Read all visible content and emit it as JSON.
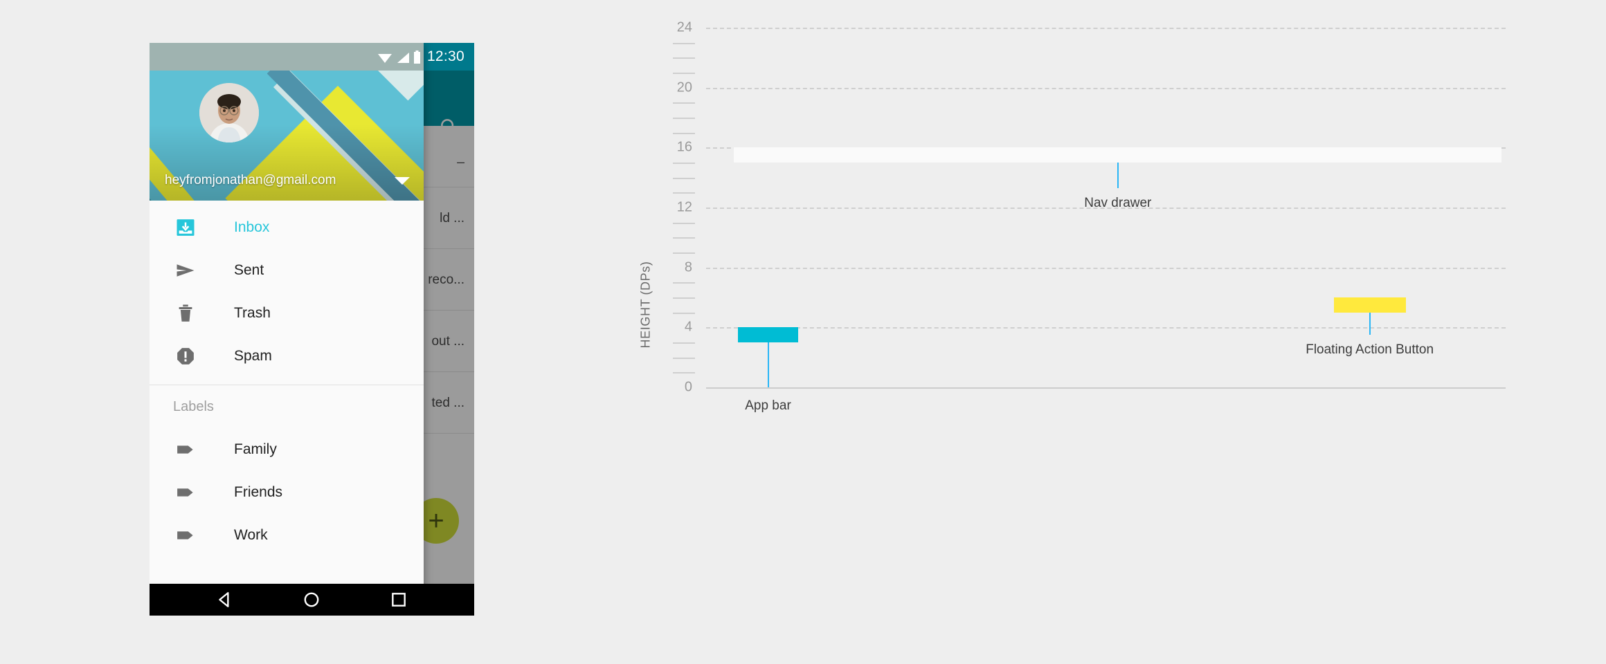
{
  "phone": {
    "status_bar": {
      "time": "12:30",
      "icons": [
        "wifi-icon",
        "signal-icon",
        "battery-icon"
      ]
    },
    "app": {
      "search_icon": "search-icon",
      "mail_snippets": [
        "_",
        "ld ...",
        "reco...",
        "out ...",
        "ted ..."
      ],
      "fab_label": "+",
      "fab_icon": "plus-icon",
      "fab_color": "#cddc39",
      "app_bar_color": "#0097a7"
    },
    "drawer": {
      "account_email": "heyfromjonathan@gmail.com",
      "account_caret_icon": "chevron-down-icon",
      "avatar": "avatar",
      "items": [
        {
          "label": "Inbox",
          "icon": "inbox-icon",
          "active": true
        },
        {
          "label": "Sent",
          "icon": "send-icon",
          "active": false
        },
        {
          "label": "Trash",
          "icon": "trash-icon",
          "active": false
        },
        {
          "label": "Spam",
          "icon": "spam-icon",
          "active": false
        }
      ],
      "section_title": "Labels",
      "labels": [
        {
          "label": "Family",
          "icon": "label-tag-icon"
        },
        {
          "label": "Friends",
          "icon": "label-tag-icon"
        },
        {
          "label": "Work",
          "icon": "label-tag-icon"
        }
      ],
      "active_color": "#26c6da"
    },
    "nav_bar": {
      "buttons": [
        {
          "name": "back-button",
          "icon": "triangle-back-icon"
        },
        {
          "name": "home-button",
          "icon": "circle-home-icon"
        },
        {
          "name": "recents-button",
          "icon": "square-recents-icon"
        }
      ]
    }
  },
  "chart_data": {
    "type": "bar",
    "title": "",
    "xlabel": "",
    "ylabel": "HEIGHT (DPs)",
    "ylim": [
      0,
      24
    ],
    "y_ticks": [
      0,
      4,
      8,
      12,
      16,
      20,
      24
    ],
    "minor_tick_step": 1,
    "grid": true,
    "legend": "none",
    "orientation": "horizontal-bands",
    "categories": [
      "App bar",
      "Nav drawer",
      "Floating Action Button"
    ],
    "values": [
      4,
      16,
      6
    ],
    "bars": [
      {
        "label": "App bar",
        "y_bottom": 3,
        "y_top": 4,
        "x_start_frac": 0.04,
        "x_end_frac": 0.115,
        "color": "#00bcd4",
        "leader_to": 0.0,
        "label_y": -0.75
      },
      {
        "label": "Nav drawer",
        "y_bottom": 15,
        "y_top": 16,
        "x_start_frac": 0.035,
        "x_end_frac": 0.995,
        "color": "#fafafa",
        "leader_to": 13.3,
        "label_y": 12.8
      },
      {
        "label": "Floating Action Button",
        "y_bottom": 5,
        "y_top": 6,
        "x_start_frac": 0.785,
        "x_end_frac": 0.875,
        "color": "#ffe93d",
        "leader_to": 3.5,
        "label_y": 3.0
      }
    ],
    "leader_color": "#29b6f6",
    "grid_color": "#cfcfcf",
    "background": "#eeeeee"
  }
}
